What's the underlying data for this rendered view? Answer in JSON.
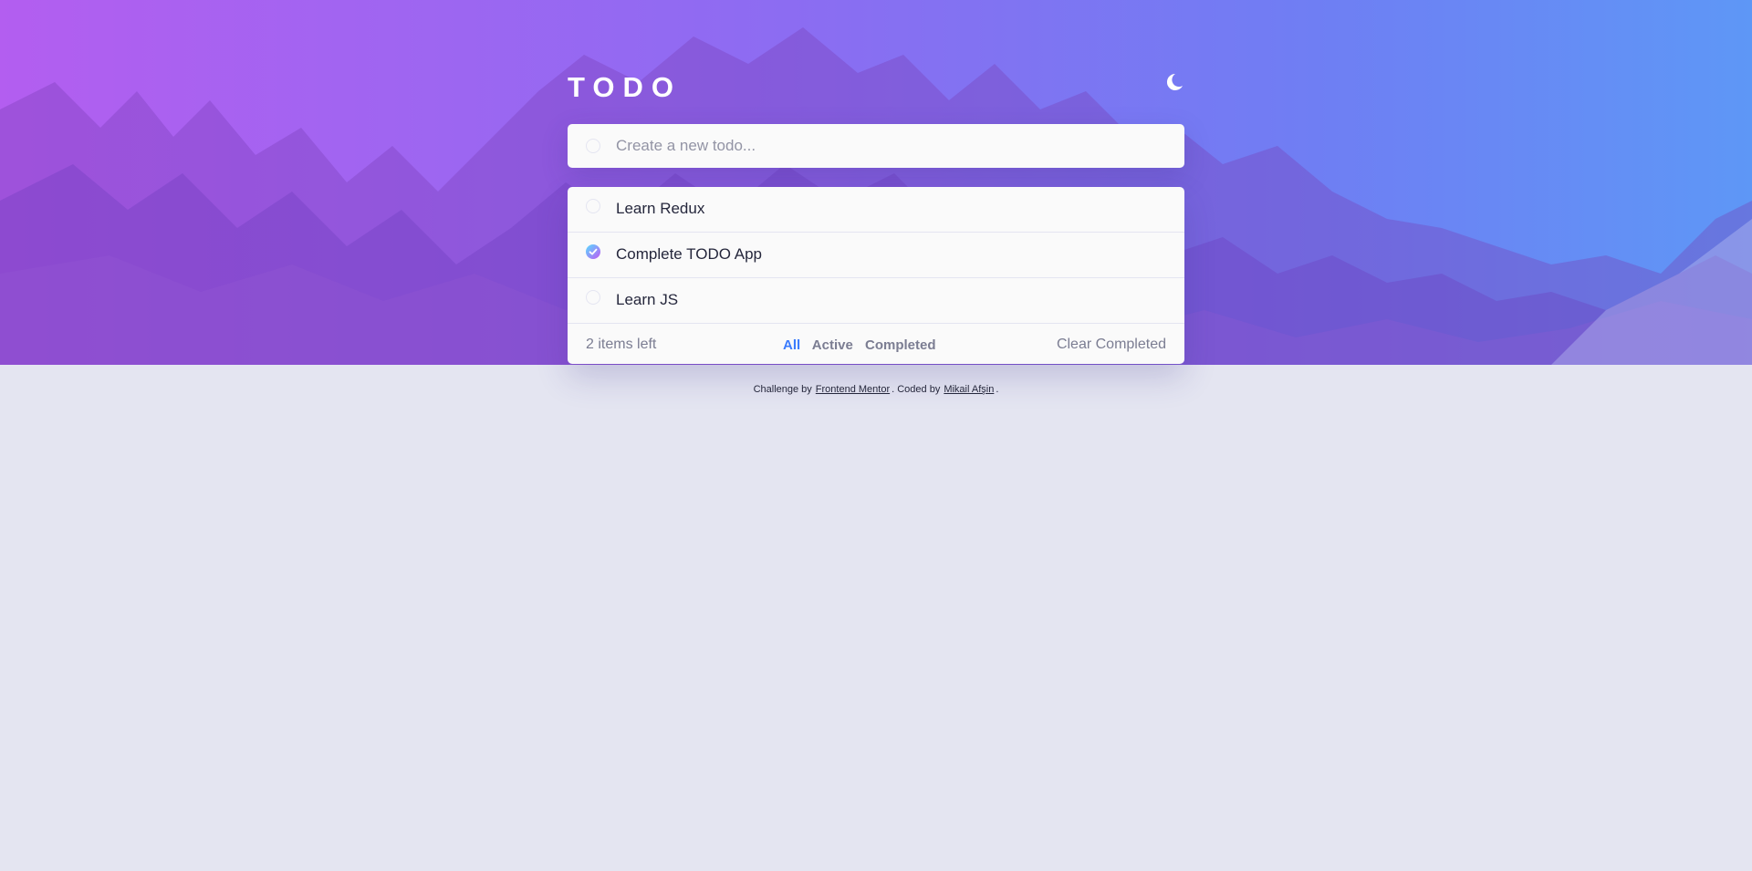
{
  "app": {
    "title": "TODO",
    "theme_icon": "moon-icon"
  },
  "new_todo": {
    "placeholder": "Create a new todo...",
    "value": ""
  },
  "todos": [
    {
      "text": "Learn Redux",
      "completed": false
    },
    {
      "text": "Complete TODO App",
      "completed": true
    },
    {
      "text": "Learn JS",
      "completed": false
    }
  ],
  "footer": {
    "items_left": "2 items left",
    "filters": [
      {
        "label": "All",
        "active": true
      },
      {
        "label": "Active",
        "active": false
      },
      {
        "label": "Completed",
        "active": false
      }
    ],
    "clear_label": "Clear Completed"
  },
  "attribution": {
    "prefix": "Challenge by",
    "link1": "Frontend Mentor",
    "middle": ". Coded by",
    "link2": "Mikail Afşin",
    "suffix": "."
  },
  "colors": {
    "gradient_start": "#b35ef0",
    "gradient_end": "#5e97f6",
    "check_gradient_start": "#57ddff",
    "check_gradient_end": "#c058f3",
    "active_filter": "#3a7bfd",
    "background": "#e4e5f1",
    "card": "#fafafa"
  }
}
